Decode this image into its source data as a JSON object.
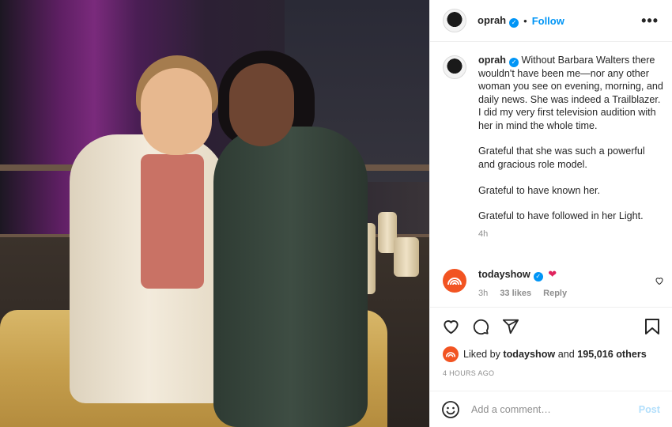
{
  "post": {
    "username": "oprah",
    "follow_label": "Follow",
    "more_label": "•••",
    "dot": "•"
  },
  "caption": {
    "username": "oprah",
    "paragraphs": [
      "Without Barbara Walters there wouldn't have been me—nor any other woman you see on evening, morning, and daily news. She was indeed a Trailblazer. I did my very first television audition with her in mind the whole time.",
      "Grateful that she was such a powerful and gracious role model.",
      "Grateful to have known her.",
      "Grateful to have followed in her Light."
    ],
    "time": "4h"
  },
  "comment": {
    "username": "todayshow",
    "time": "3h",
    "likes": "33 likes",
    "reply_label": "Reply"
  },
  "likes": {
    "prefix": "Liked by",
    "user": "todayshow",
    "and": "and",
    "count": "195,016 others"
  },
  "posted_ago": "4 HOURS AGO",
  "add_comment": {
    "placeholder": "Add a comment…",
    "post_label": "Post"
  },
  "colors": {
    "verified": "#0095f6",
    "follow": "#0095f6",
    "todayshow_brand": "#f25422",
    "heart": "#e0245e",
    "post_disabled": "#b2dffc"
  },
  "icons": [
    "verified-badge-icon",
    "more-options-icon",
    "heart-icon",
    "comment-icon",
    "share-icon",
    "bookmark-icon",
    "emoji-icon",
    "rainbow-logo-icon"
  ]
}
